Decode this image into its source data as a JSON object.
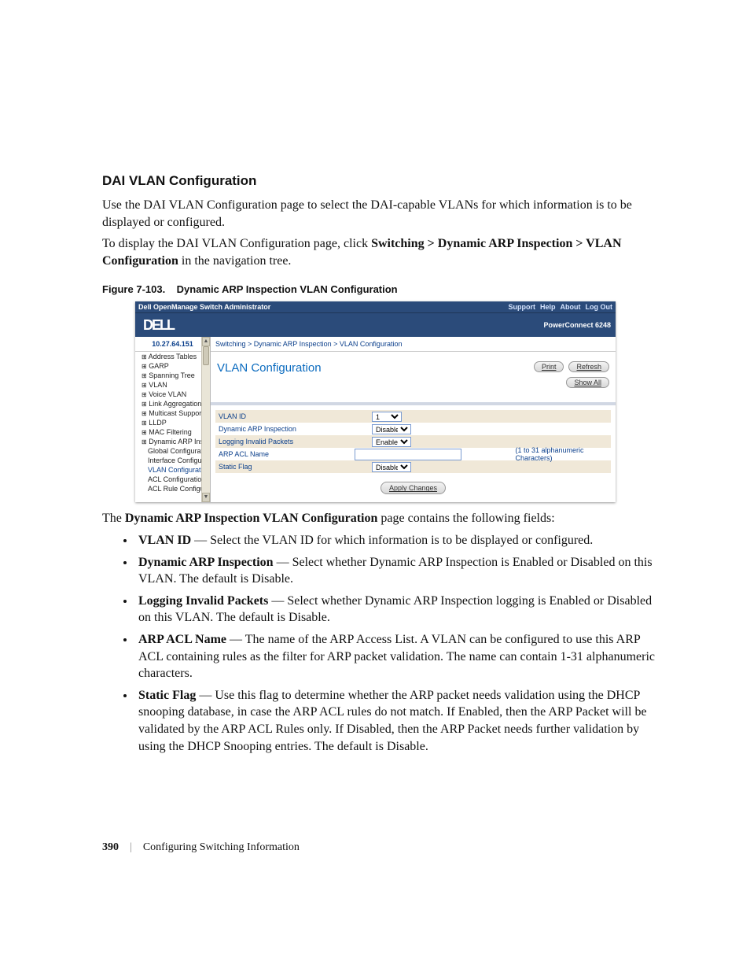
{
  "section_title": "DAI VLAN Configuration",
  "intro_1": "Use the DAI VLAN Configuration page to select the DAI-capable VLANs for which information is to be displayed or configured.",
  "intro_2_prefix": "To display the DAI VLAN Configuration page, click ",
  "intro_2_bold": "Switching > Dynamic ARP Inspection > VLAN Configuration",
  "intro_2_suffix": " in the navigation tree.",
  "figure_caption_number": "Figure 7-103.",
  "figure_caption_title": "Dynamic ARP Inspection VLAN Configuration",
  "screenshot": {
    "topbar_title": "Dell OpenManage Switch Administrator",
    "toplinks": [
      "Support",
      "Help",
      "About",
      "Log Out"
    ],
    "logo_text": "DELL",
    "model": "PowerConnect 6248",
    "ip": "10.27.64.151",
    "breadcrumb": "Switching > Dynamic ARP Inspection > VLAN Configuration",
    "nav": {
      "items": [
        "Address Tables",
        "GARP",
        "Spanning Tree",
        "VLAN",
        "Voice VLAN",
        "Link Aggregation",
        "Multicast Support",
        "LLDP",
        "MAC Filtering",
        "Dynamic ARP Inspe"
      ],
      "sub": [
        "Global Configurat",
        "Interface Configu",
        "VLAN Configurat",
        "ACL Configuratio",
        "ACL Rule Configu"
      ],
      "active_sub_index": 2
    },
    "panel_title": "VLAN Configuration",
    "btn_print": "Print",
    "btn_refresh": "Refresh",
    "btn_showall": "Show All",
    "rows": [
      {
        "label": "VLAN ID",
        "type": "select",
        "value": "1",
        "cls": "w1",
        "alt": true
      },
      {
        "label": "Dynamic ARP Inspection",
        "type": "select",
        "value": "Disable",
        "cls": "w2",
        "alt": false
      },
      {
        "label": "Logging Invalid Packets",
        "type": "select",
        "value": "Enable",
        "cls": "w2",
        "alt": true
      },
      {
        "label": "ARP ACL Name",
        "type": "input",
        "value": "",
        "hint": "(1 to 31 alphanumeric Characters)",
        "alt": false
      },
      {
        "label": "Static Flag",
        "type": "select",
        "value": "Disable",
        "cls": "w2",
        "alt": true
      }
    ],
    "apply_label": "Apply Changes"
  },
  "after_intro_prefix": "The ",
  "after_intro_bold": "Dynamic ARP Inspection VLAN Configuration",
  "after_intro_suffix": " page contains the following fields:",
  "bullets": [
    {
      "term": "VLAN ID",
      "desc": " — Select the VLAN ID for which information is to be displayed or configured."
    },
    {
      "term": "Dynamic ARP Inspection",
      "desc": " — Select whether Dynamic ARP Inspection is Enabled or Disabled on this VLAN. The default is Disable."
    },
    {
      "term": "Logging Invalid Packets",
      "desc": " — Select whether Dynamic ARP Inspection logging is Enabled or Disabled on this VLAN. The default is Disable."
    },
    {
      "term": "ARP ACL Name",
      "desc": " — The name of the ARP Access List. A VLAN can be configured to use this ARP ACL containing rules as the filter for ARP packet validation. The name can contain 1-31 alphanumeric characters."
    },
    {
      "term": "Static Flag",
      "desc": " — Use this flag to determine whether the ARP packet needs validation using the DHCP snooping database, in case the ARP ACL rules do not match. If Enabled, then the ARP Packet will be validated by the ARP ACL Rules only. If Disabled, then the ARP Packet needs further validation by using the DHCP Snooping entries. The default is Disable."
    }
  ],
  "footer": {
    "page": "390",
    "sep": "|",
    "section": "Configuring Switching Information"
  }
}
